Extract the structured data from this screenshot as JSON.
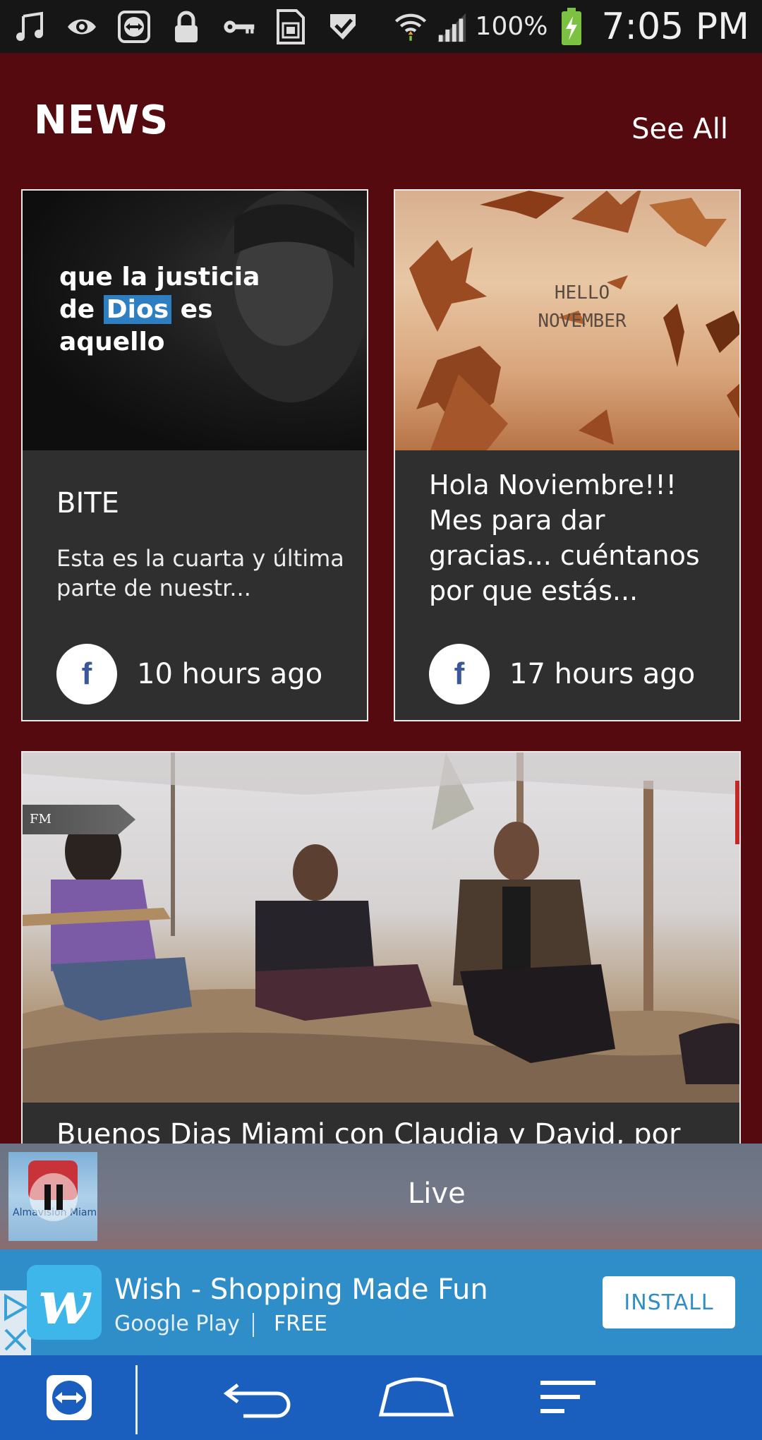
{
  "status_bar": {
    "icons": [
      "music-note-icon",
      "eye-icon",
      "teamviewer-icon",
      "lock-icon",
      "key-icon",
      "sd-card-icon",
      "check-icon",
      "wifi-icon",
      "signal-icon",
      "battery-icon"
    ],
    "battery_pct": "100%",
    "time": "7:05 PM"
  },
  "header": {
    "title": "NEWS",
    "see_all": "See All"
  },
  "cards": [
    {
      "overlay_text": [
        "que la justicia",
        "de",
        "Dios",
        "es",
        "aquello"
      ],
      "title": "BITE",
      "description": "Esta es la cuarta y última parte de nuestr...",
      "source_icon": "facebook-icon",
      "time_ago": "10 hours ago"
    },
    {
      "overlay_text": [
        "HELLO",
        "NOVEMBER"
      ],
      "title": "Hola Noviembre!!! Mes para dar gracias... cuéntanos por que estás...",
      "source_icon": "facebook-icon",
      "time_ago": "17 hours ago"
    },
    {
      "tag": "FM",
      "caption": "Buenos Dias Miami con Claudia y David, por"
    }
  ],
  "player": {
    "thumb_label": "Almavision Miami",
    "status": "Live"
  },
  "ad": {
    "title": "Wish - Shopping Made Fun",
    "store": "Google Play",
    "price": "FREE",
    "install": "INSTALL",
    "brand_color": "#3eb6e9"
  },
  "navbar": {
    "icons": [
      "teamviewer-icon",
      "back-icon",
      "home-icon",
      "recent-apps-icon"
    ]
  }
}
